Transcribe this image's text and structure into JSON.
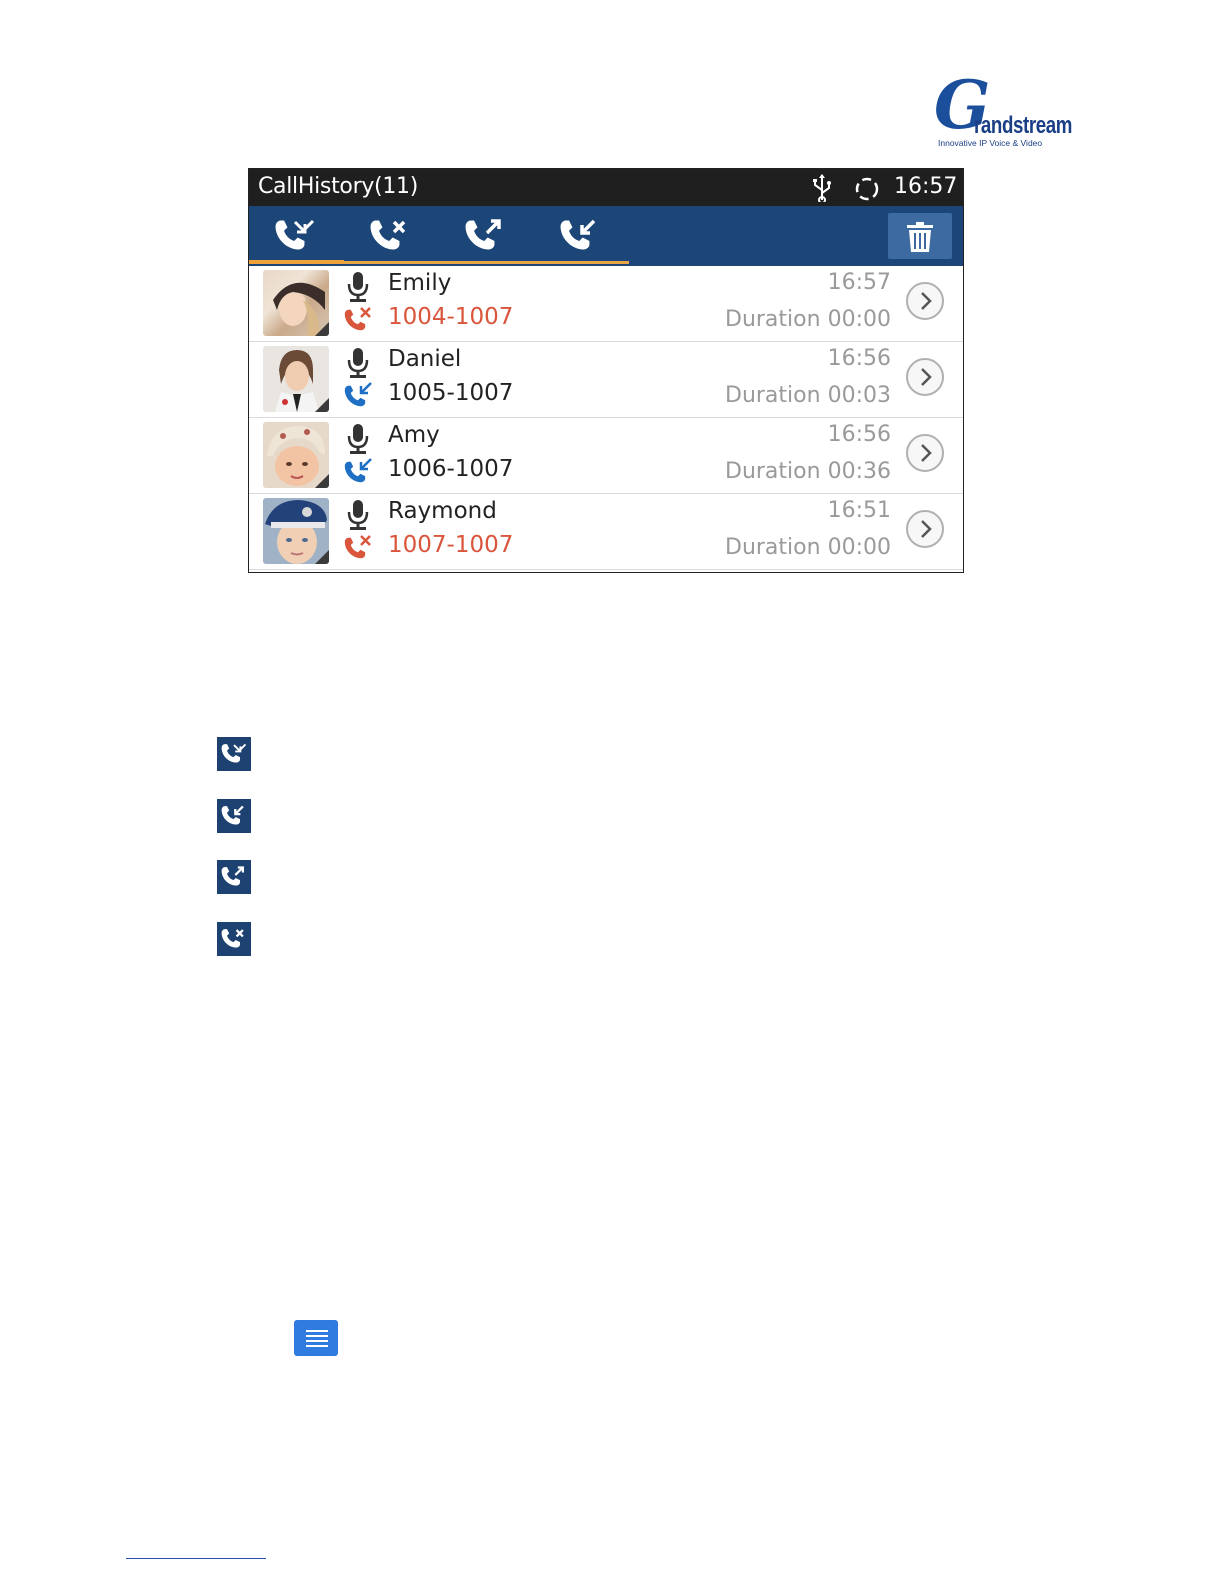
{
  "logo": {
    "letter": "G",
    "word": "randstream",
    "tagline": "Innovative IP Voice & Video"
  },
  "statusbar": {
    "title": "CallHistory(11)",
    "time": "16:57",
    "icons": [
      "usb-icon",
      "sync-icon"
    ]
  },
  "tabs": [
    {
      "name": "all-calls",
      "icon": "all-calls-icon",
      "selected": true
    },
    {
      "name": "missed-calls",
      "icon": "missed-call-icon",
      "selected": false
    },
    {
      "name": "outgoing-calls",
      "icon": "outgoing-call-icon",
      "selected": false
    },
    {
      "name": "incoming-calls",
      "icon": "incoming-call-icon",
      "selected": false
    }
  ],
  "toolbar": {
    "delete_icon": "trash-icon"
  },
  "calls": [
    {
      "name": "Emily",
      "number": "1004-1007",
      "time": "16:57",
      "duration_label": "Duration",
      "duration": "00:00",
      "type": "missed"
    },
    {
      "name": "Daniel",
      "number": "1005-1007",
      "time": "16:56",
      "duration_label": "Duration",
      "duration": "00:03",
      "type": "incoming"
    },
    {
      "name": "Amy",
      "number": "1006-1007",
      "time": "16:56",
      "duration_label": "Duration",
      "duration": "00:36",
      "type": "incoming"
    },
    {
      "name": "Raymond",
      "number": "1007-1007",
      "time": "16:51",
      "duration_label": "Duration",
      "duration": "00:00",
      "type": "missed"
    }
  ],
  "legend": [
    "all-calls-icon",
    "incoming-call-icon",
    "outgoing-call-icon",
    "missed-call-icon"
  ],
  "colors": {
    "tabbar": "#1c4677",
    "statusbar": "#1f1f1f",
    "accent": "#f0a23a",
    "missed": "#d9553b",
    "incoming": "#1f6fc4",
    "menu_button": "#2f7be0"
  }
}
